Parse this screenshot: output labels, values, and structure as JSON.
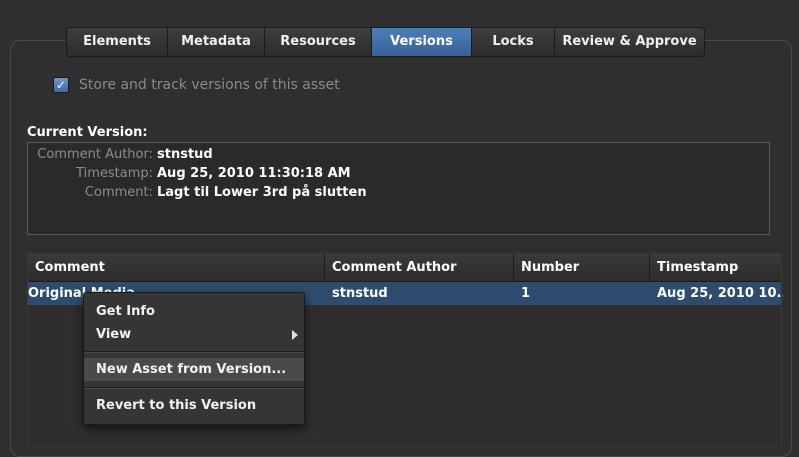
{
  "tabs": [
    {
      "label": "Elements",
      "active": false
    },
    {
      "label": "Metadata",
      "active": false
    },
    {
      "label": "Resources",
      "active": false
    },
    {
      "label": "Versions",
      "active": true
    },
    {
      "label": "Locks",
      "active": false
    },
    {
      "label": "Review & Approve",
      "active": false
    }
  ],
  "track_versions": {
    "label": "Store and track versions of this asset",
    "checked": true
  },
  "current_version": {
    "title": "Current Version:",
    "author_label": "Comment Author:",
    "author": "stnstud",
    "timestamp_label": "Timestamp:",
    "timestamp": "Aug 25, 2010 11:30:18 AM",
    "comment_label": "Comment:",
    "comment": "Lagt til Lower 3rd på slutten"
  },
  "versions_table": {
    "columns": [
      "Comment",
      "Comment Author",
      "Number",
      "Timestamp"
    ],
    "rows": [
      {
        "comment": "Original Media",
        "author": "stnstud",
        "number": "1",
        "timestamp": "Aug 25, 2010 10..."
      }
    ]
  },
  "context_menu": {
    "items": [
      "Get Info",
      "View",
      "New Asset from Version...",
      "Revert to this Version"
    ],
    "highlighted": "New Asset from Version..."
  },
  "colors": {
    "accent": "#4a7bb7",
    "selection": "#2f4c6e",
    "background": "#2f2f2f"
  }
}
